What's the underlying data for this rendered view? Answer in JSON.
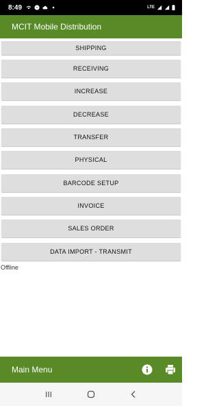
{
  "status_bar": {
    "time": "8:49",
    "network_label": "LTE"
  },
  "app_bar": {
    "title": "MCIT Mobile Distribution"
  },
  "menu": {
    "items": [
      {
        "label": "SHIPPING"
      },
      {
        "label": "RECEIVING"
      },
      {
        "label": "INCREASE"
      },
      {
        "label": "DECREASE"
      },
      {
        "label": "TRANSFER"
      },
      {
        "label": "PHYSICAL"
      },
      {
        "label": "BARCODE SETUP"
      },
      {
        "label": "INVOICE"
      },
      {
        "label": "SALES ORDER"
      },
      {
        "label": "DATA IMPORT - TRANSMIT"
      }
    ]
  },
  "status_text": "Offline",
  "bottom_bar": {
    "title": "Main Menu",
    "actions": [
      {
        "icon": "info-icon"
      },
      {
        "icon": "print-icon"
      }
    ]
  },
  "colors": {
    "accent": "#588a27",
    "button_bg": "#dedede"
  }
}
